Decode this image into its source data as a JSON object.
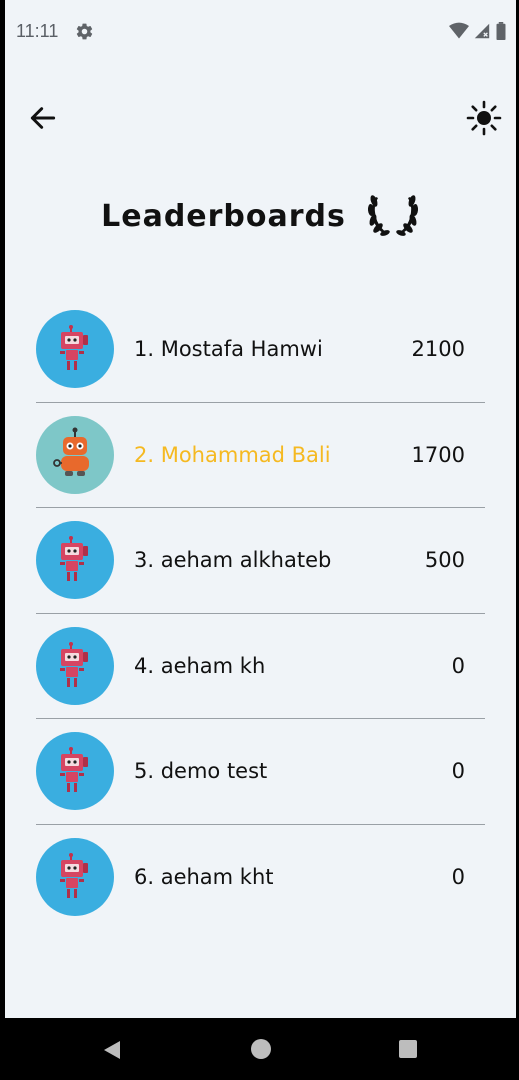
{
  "status_bar": {
    "time": "11:11",
    "icons": [
      "gear-icon",
      "wifi-icon",
      "signal-icon",
      "battery-icon"
    ]
  },
  "top_bar": {
    "back_icon": "arrow-left-icon",
    "theme_icon": "sun-icon"
  },
  "header": {
    "title": "Leaderboards",
    "icon": "laurel-wreath-icon"
  },
  "leaderboard": [
    {
      "name": "1. Mostafa Hamwi",
      "score": "2100",
      "avatar": "red-robot-icon",
      "highlight": false
    },
    {
      "name": "2. Mohammad Bali",
      "score": "1700",
      "avatar": "orange-robot-icon",
      "highlight": true
    },
    {
      "name": "3. aeham alkhateb",
      "score": "500",
      "avatar": "red-robot-icon",
      "highlight": false
    },
    {
      "name": "4. aeham kh",
      "score": "0",
      "avatar": "red-robot-icon",
      "highlight": false
    },
    {
      "name": "5. demo test",
      "score": "0",
      "avatar": "red-robot-icon",
      "highlight": false
    },
    {
      "name": "6. aeham kht",
      "score": "0",
      "avatar": "red-robot-icon",
      "highlight": false
    }
  ],
  "colors": {
    "background": "#f0f4f8",
    "avatar_blue": "#3aaee0",
    "avatar_teal": "#7ec7c8",
    "highlight": "#f5b921",
    "divider": "#9aa0a6"
  },
  "nav_bar": {
    "icons": [
      "nav-back-icon",
      "nav-home-icon",
      "nav-recents-icon"
    ]
  }
}
